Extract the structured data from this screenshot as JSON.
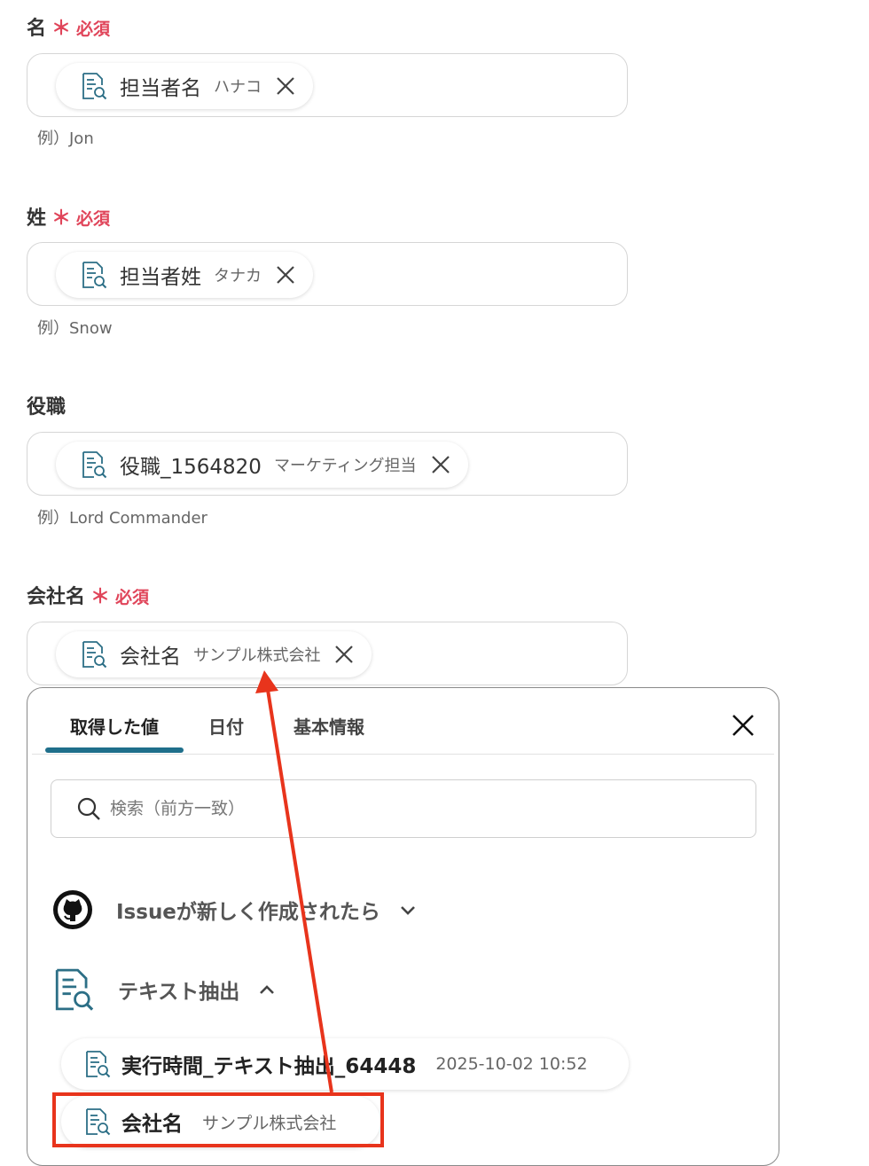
{
  "fields": [
    {
      "label": "名",
      "required": "必須",
      "chip_name": "担当者名",
      "chip_value": "ハナコ",
      "example": "例）Jon"
    },
    {
      "label": "姓",
      "required": "必須",
      "chip_name": "担当者姓",
      "chip_value": "タナカ",
      "example": "例）Snow"
    },
    {
      "label": "役職",
      "required": "",
      "chip_name": "役職_1564820",
      "chip_value": "マーケティング担当",
      "example": "例）Lord Commander"
    },
    {
      "label": "会社名",
      "required": "必須",
      "chip_name": "会社名",
      "chip_value": "サンプル株式会社",
      "example": ""
    }
  ],
  "required_star": "＊",
  "panel": {
    "tabs": [
      {
        "label": "取得した値",
        "active": true
      },
      {
        "label": "日付",
        "active": false
      },
      {
        "label": "基本情報",
        "active": false
      }
    ],
    "search_placeholder": "検索（前方一致）",
    "groups": [
      {
        "title": "Issueが新しく作成されたら",
        "icon": "github-icon",
        "expanded": false
      },
      {
        "title": "テキスト抽出",
        "icon": "document-search-icon",
        "expanded": true
      }
    ],
    "items": [
      {
        "name": "実行時間_テキスト抽出_64448",
        "value": "2025-10-02 10:52"
      },
      {
        "name": "会社名",
        "value": "サンプル株式会社"
      }
    ]
  },
  "colors": {
    "required": "#e0455a",
    "accent": "#1f6f8b",
    "annotation": "#e8341c"
  }
}
